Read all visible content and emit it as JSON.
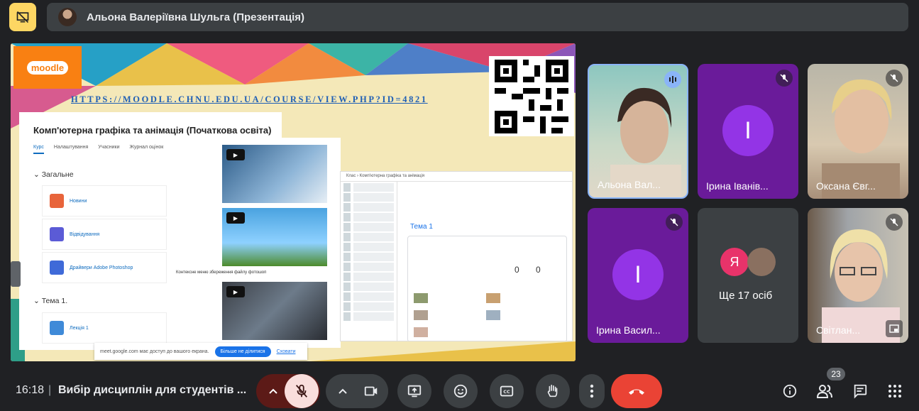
{
  "top": {
    "presenter_title": "Альона Валеріївна Шульга (Презентація)"
  },
  "presentation": {
    "logo_text": "moodle",
    "url": "HTTPS://MOODLE.CHNU.EDU.UA/COURSE/VIEW.PHP?ID=4821",
    "course_title": "Комп'ютерна графіка та анімація (Початкова освіта)",
    "tabs": [
      "Курс",
      "Налаштування",
      "Учасники",
      "Журнал оцінок"
    ],
    "section_general": "Загальне",
    "activities": [
      "Новини",
      "Відвідування",
      "Драйвери Adobe Photoshop"
    ],
    "section_tema": "Тема 1.",
    "lecture": "Лекція 1",
    "video_caption": "Контексне меню збереження файлу фотошоп",
    "classroom": {
      "breadcrumb": "Клас  ›  Комп'ютерна графіка та анімація",
      "tema": "Тема 1",
      "num_handed": "0",
      "num_assigned": "0"
    },
    "share": {
      "text": "meet.google.com має доступ до вашого екрана.",
      "stop": "Більше не ділитися",
      "hide": "Сховати"
    }
  },
  "participants": [
    {
      "name": "Альона Вал...",
      "speaking": true
    },
    {
      "name": "Ірина Іванів...",
      "letter": "І",
      "muted": true
    },
    {
      "name": "Оксана Євг...",
      "muted": true
    },
    {
      "name": "Ірина Васил...",
      "letter": "І",
      "muted": true
    },
    {
      "name": "Ще 17 осіб",
      "avatar_letter": "Я"
    },
    {
      "name": "Світлан...",
      "muted": true
    }
  ],
  "bottom": {
    "time": "16:18",
    "separator": "|",
    "meeting_name": "Вибір дисциплін для студентів ...",
    "participant_count": "23"
  },
  "colors": {
    "background": "#202124",
    "control": "#3c4043",
    "end_call": "#ea4335",
    "mic_off": "#f9dedc",
    "present": "#fdd663",
    "avatar_purple": "#9334e6"
  }
}
